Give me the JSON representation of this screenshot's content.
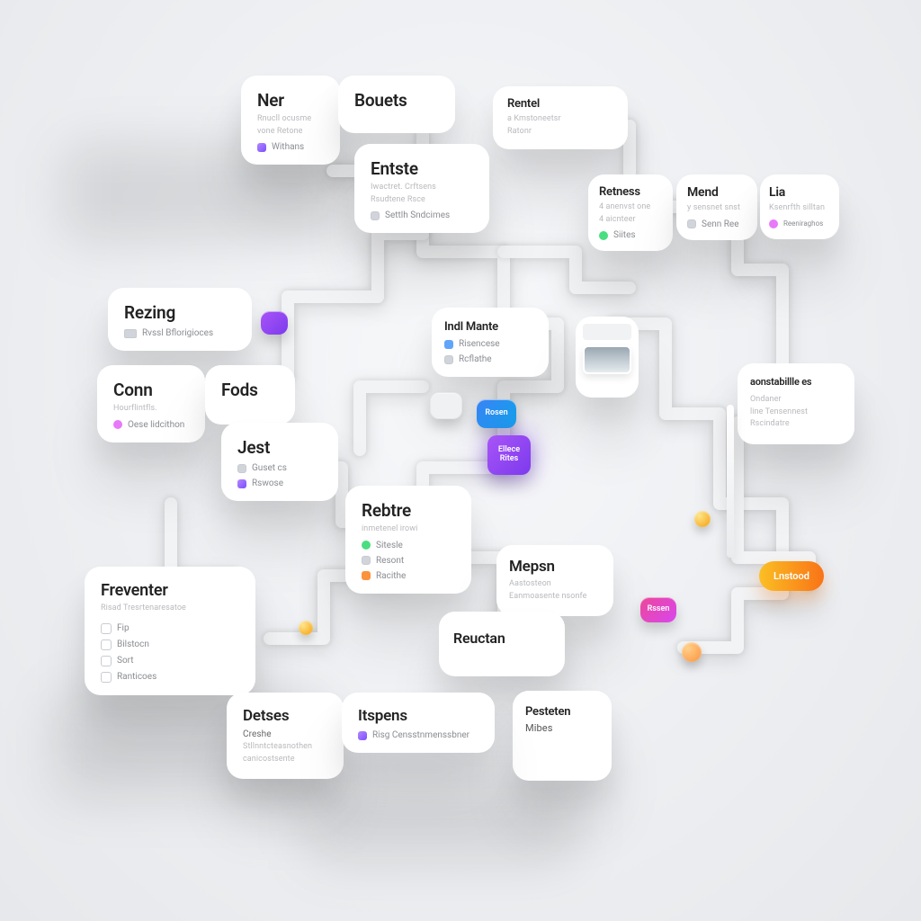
{
  "cards": {
    "ner": {
      "title": "Ner",
      "sub1": "Rnucll ocusme",
      "sub2": "vone Retone",
      "rowlabel": "Withans"
    },
    "bouets": {
      "title": "Bouets"
    },
    "rentel": {
      "title": "Rentel",
      "sub1": "a Kmstoneetsr",
      "sub2": "Ratonr"
    },
    "entste": {
      "title": "Entste",
      "sub1": "Iwactret. Crftsens",
      "sub2": "Rsudtene  Rsce",
      "rowlabel": "Settlh Sndcimes"
    },
    "hetness": {
      "title": "Retness",
      "sub1": "4 anenvst one",
      "sub2": "4 aicnteer",
      "rowlabel": "Siites"
    },
    "mend": {
      "title": "Mend",
      "sub1": "y sensnet snst",
      "sub2": "",
      "rowlabel": "Senn Ree"
    },
    "lia": {
      "title": "Lia",
      "sub1": "Ksenrfth silltan",
      "sub2": "",
      "rowlabel": "Reeniraghos"
    },
    "rezing": {
      "title": "Rezing",
      "sub1": "",
      "rowlabel": "Rvssl  Bflorigioces"
    },
    "conn": {
      "title": "Conn",
      "sub1": "Hourflintfls.",
      "rowlabel": "Oese lidcithon"
    },
    "fods": {
      "title": "Fods"
    },
    "jest": {
      "title": "Jest",
      "row1": "Guset  cs",
      "row2": "Rswose"
    },
    "indl": {
      "title": "Indl Mante",
      "row1": "Risencese",
      "row2": "Rcflathe"
    },
    "rebtre": {
      "title": "Rebtre",
      "sub1": "inmetenel irowi",
      "row1": "Sitesle",
      "row2": "Resont",
      "row3": "Racithe"
    },
    "mepsn": {
      "title": "Mepsn",
      "sub1": "Aastosteon",
      "sub2": "Eanmoasente  nsonfe"
    },
    "reuctan": {
      "title": "Reuctan"
    },
    "pesteten": {
      "title": "Pesteten",
      "sub": "Mibes"
    },
    "freventer": {
      "title": "Freventer",
      "sub": "Risad Tresrtenaresatoe",
      "items": [
        "Fip",
        "Bilstocn",
        "Sort",
        "Ranticoes"
      ]
    },
    "detses": {
      "title": "Detses",
      "sub1": "Creshe",
      "sub2": "Stllnntcteasnothen",
      "sub3": "canicostsente"
    },
    "itspens": {
      "title": "Itspens",
      "rowlabel": "Risg Censstnmenssbner"
    },
    "membl": {
      "title": "aonstabillle es",
      "sub1": "Ondaner",
      "sub2": "line Tensennest",
      "sub3": "Rscindatre"
    }
  },
  "chips": {
    "purple_top": "",
    "blue": "Rosen",
    "purple_main": "Ellece\nRites",
    "magenta": "Rssen",
    "gray": ""
  },
  "pill": "Lnstood",
  "colors": {
    "accent_purple": "#7c3aed",
    "accent_blue": "#0ea5e9",
    "accent_orange": "#f97316",
    "accent_magenta": "#d946ef"
  }
}
